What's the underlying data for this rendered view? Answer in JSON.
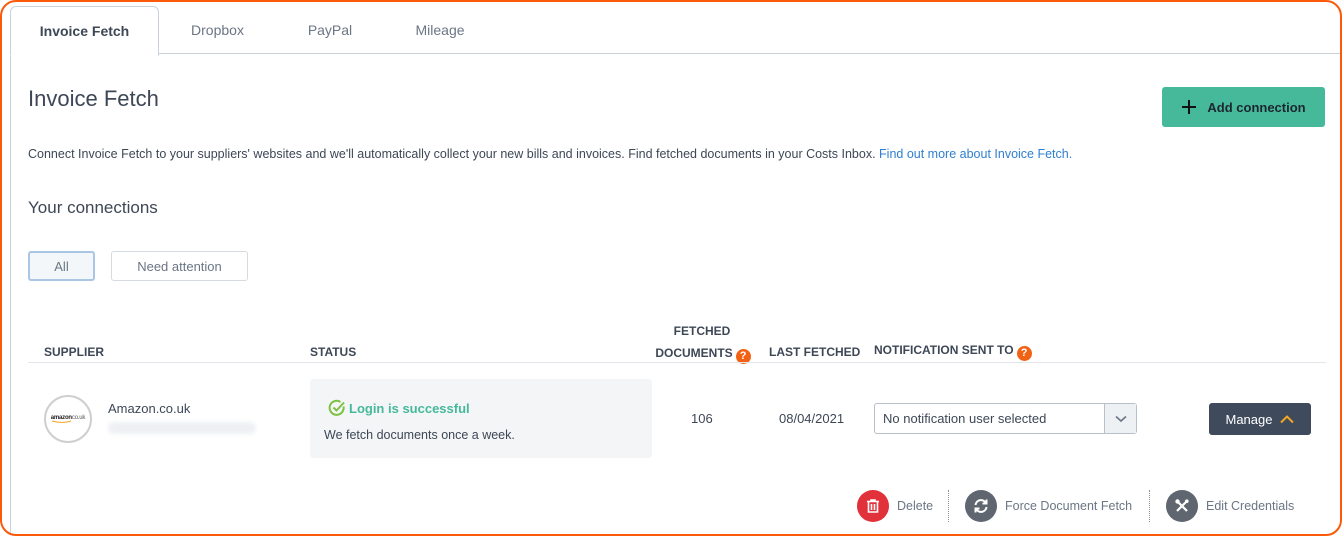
{
  "tabs": [
    {
      "label": "Invoice Fetch",
      "active": true
    },
    {
      "label": "Dropbox",
      "active": false
    },
    {
      "label": "PayPal",
      "active": false
    },
    {
      "label": "Mileage",
      "active": false
    }
  ],
  "header": {
    "title": "Invoice Fetch",
    "add_button_label": "Add connection",
    "add_button_icon": "plus-icon",
    "intro_text": "Connect Invoice Fetch to your suppliers' websites and we'll automatically collect your new bills and invoices. Find fetched documents in your Costs Inbox.",
    "intro_link": "Find out more about Invoice Fetch."
  },
  "connections": {
    "title": "Your connections",
    "filters": [
      {
        "label": "All",
        "active": true
      },
      {
        "label": "Need attention",
        "active": false
      }
    ],
    "columns": {
      "supplier": "SUPPLIER",
      "status": "STATUS",
      "fetched_line1": "FETCHED",
      "fetched_line2": "DOCUMENTS",
      "last_fetched": "LAST FETCHED",
      "notification": "NOTIFICATION SENT TO",
      "help_glyph": "?"
    },
    "rows": [
      {
        "supplier_name": "Amazon.co.uk",
        "logo_text": "amazon",
        "logo_suffix": "co.uk",
        "status_title": "Login is successful",
        "status_desc": "We fetch documents once a week.",
        "fetched_documents": "106",
        "last_fetched": "08/04/2021",
        "notification_selected": "No notification user selected",
        "manage_label": "Manage"
      }
    ],
    "actions": [
      {
        "label": "Delete",
        "icon": "trash-icon",
        "color": "#e1323b"
      },
      {
        "label": "Force Document Fetch",
        "icon": "refresh-icon",
        "color": "#5f6670"
      },
      {
        "label": "Edit Credentials",
        "icon": "tools-icon",
        "color": "#5f6670"
      }
    ]
  },
  "colors": {
    "frame": "#fa5a0a",
    "primary": "#46b99b",
    "link": "#2f7fd1",
    "help": "#f26215",
    "manage": "#3f4a5c",
    "chevron": "#f5a623"
  }
}
